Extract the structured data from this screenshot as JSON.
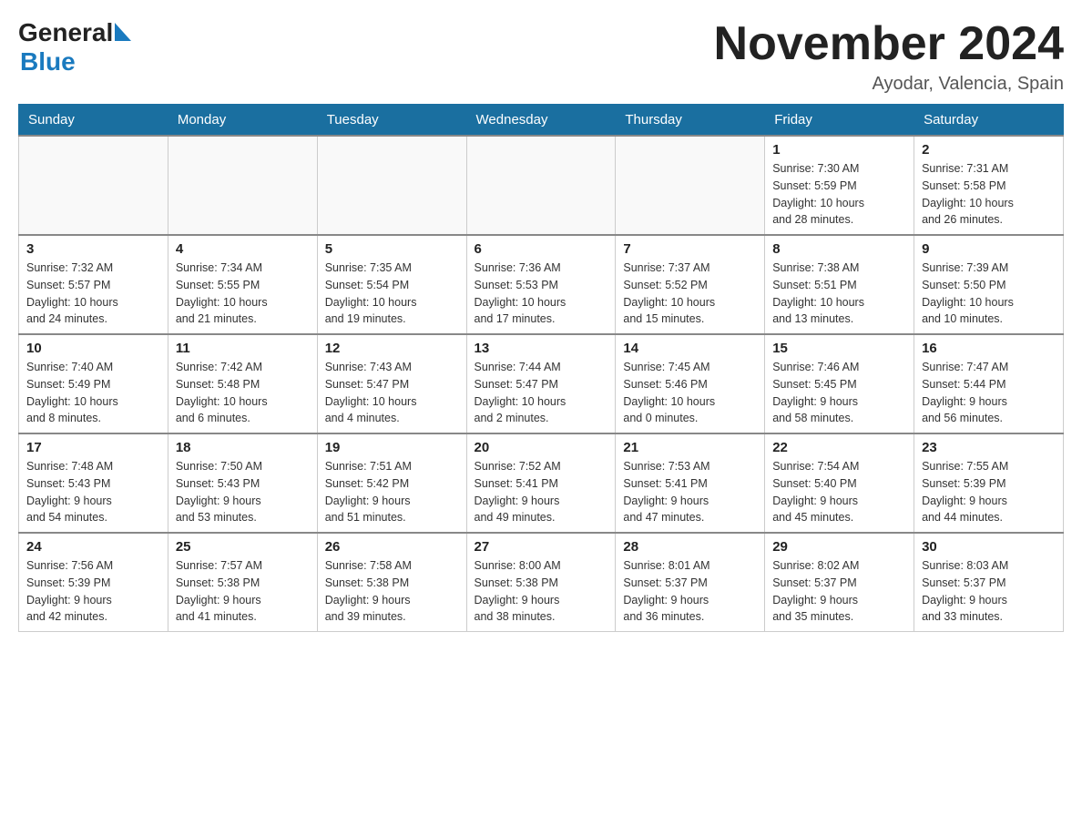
{
  "header": {
    "logo": {
      "general_text": "General",
      "blue_text": "Blue"
    },
    "title": "November 2024",
    "subtitle": "Ayodar, Valencia, Spain"
  },
  "weekdays": [
    "Sunday",
    "Monday",
    "Tuesday",
    "Wednesday",
    "Thursday",
    "Friday",
    "Saturday"
  ],
  "weeks": [
    [
      {
        "day": "",
        "info": ""
      },
      {
        "day": "",
        "info": ""
      },
      {
        "day": "",
        "info": ""
      },
      {
        "day": "",
        "info": ""
      },
      {
        "day": "",
        "info": ""
      },
      {
        "day": "1",
        "info": "Sunrise: 7:30 AM\nSunset: 5:59 PM\nDaylight: 10 hours\nand 28 minutes."
      },
      {
        "day": "2",
        "info": "Sunrise: 7:31 AM\nSunset: 5:58 PM\nDaylight: 10 hours\nand 26 minutes."
      }
    ],
    [
      {
        "day": "3",
        "info": "Sunrise: 7:32 AM\nSunset: 5:57 PM\nDaylight: 10 hours\nand 24 minutes."
      },
      {
        "day": "4",
        "info": "Sunrise: 7:34 AM\nSunset: 5:55 PM\nDaylight: 10 hours\nand 21 minutes."
      },
      {
        "day": "5",
        "info": "Sunrise: 7:35 AM\nSunset: 5:54 PM\nDaylight: 10 hours\nand 19 minutes."
      },
      {
        "day": "6",
        "info": "Sunrise: 7:36 AM\nSunset: 5:53 PM\nDaylight: 10 hours\nand 17 minutes."
      },
      {
        "day": "7",
        "info": "Sunrise: 7:37 AM\nSunset: 5:52 PM\nDaylight: 10 hours\nand 15 minutes."
      },
      {
        "day": "8",
        "info": "Sunrise: 7:38 AM\nSunset: 5:51 PM\nDaylight: 10 hours\nand 13 minutes."
      },
      {
        "day": "9",
        "info": "Sunrise: 7:39 AM\nSunset: 5:50 PM\nDaylight: 10 hours\nand 10 minutes."
      }
    ],
    [
      {
        "day": "10",
        "info": "Sunrise: 7:40 AM\nSunset: 5:49 PM\nDaylight: 10 hours\nand 8 minutes."
      },
      {
        "day": "11",
        "info": "Sunrise: 7:42 AM\nSunset: 5:48 PM\nDaylight: 10 hours\nand 6 minutes."
      },
      {
        "day": "12",
        "info": "Sunrise: 7:43 AM\nSunset: 5:47 PM\nDaylight: 10 hours\nand 4 minutes."
      },
      {
        "day": "13",
        "info": "Sunrise: 7:44 AM\nSunset: 5:47 PM\nDaylight: 10 hours\nand 2 minutes."
      },
      {
        "day": "14",
        "info": "Sunrise: 7:45 AM\nSunset: 5:46 PM\nDaylight: 10 hours\nand 0 minutes."
      },
      {
        "day": "15",
        "info": "Sunrise: 7:46 AM\nSunset: 5:45 PM\nDaylight: 9 hours\nand 58 minutes."
      },
      {
        "day": "16",
        "info": "Sunrise: 7:47 AM\nSunset: 5:44 PM\nDaylight: 9 hours\nand 56 minutes."
      }
    ],
    [
      {
        "day": "17",
        "info": "Sunrise: 7:48 AM\nSunset: 5:43 PM\nDaylight: 9 hours\nand 54 minutes."
      },
      {
        "day": "18",
        "info": "Sunrise: 7:50 AM\nSunset: 5:43 PM\nDaylight: 9 hours\nand 53 minutes."
      },
      {
        "day": "19",
        "info": "Sunrise: 7:51 AM\nSunset: 5:42 PM\nDaylight: 9 hours\nand 51 minutes."
      },
      {
        "day": "20",
        "info": "Sunrise: 7:52 AM\nSunset: 5:41 PM\nDaylight: 9 hours\nand 49 minutes."
      },
      {
        "day": "21",
        "info": "Sunrise: 7:53 AM\nSunset: 5:41 PM\nDaylight: 9 hours\nand 47 minutes."
      },
      {
        "day": "22",
        "info": "Sunrise: 7:54 AM\nSunset: 5:40 PM\nDaylight: 9 hours\nand 45 minutes."
      },
      {
        "day": "23",
        "info": "Sunrise: 7:55 AM\nSunset: 5:39 PM\nDaylight: 9 hours\nand 44 minutes."
      }
    ],
    [
      {
        "day": "24",
        "info": "Sunrise: 7:56 AM\nSunset: 5:39 PM\nDaylight: 9 hours\nand 42 minutes."
      },
      {
        "day": "25",
        "info": "Sunrise: 7:57 AM\nSunset: 5:38 PM\nDaylight: 9 hours\nand 41 minutes."
      },
      {
        "day": "26",
        "info": "Sunrise: 7:58 AM\nSunset: 5:38 PM\nDaylight: 9 hours\nand 39 minutes."
      },
      {
        "day": "27",
        "info": "Sunrise: 8:00 AM\nSunset: 5:38 PM\nDaylight: 9 hours\nand 38 minutes."
      },
      {
        "day": "28",
        "info": "Sunrise: 8:01 AM\nSunset: 5:37 PM\nDaylight: 9 hours\nand 36 minutes."
      },
      {
        "day": "29",
        "info": "Sunrise: 8:02 AM\nSunset: 5:37 PM\nDaylight: 9 hours\nand 35 minutes."
      },
      {
        "day": "30",
        "info": "Sunrise: 8:03 AM\nSunset: 5:37 PM\nDaylight: 9 hours\nand 33 minutes."
      }
    ]
  ]
}
